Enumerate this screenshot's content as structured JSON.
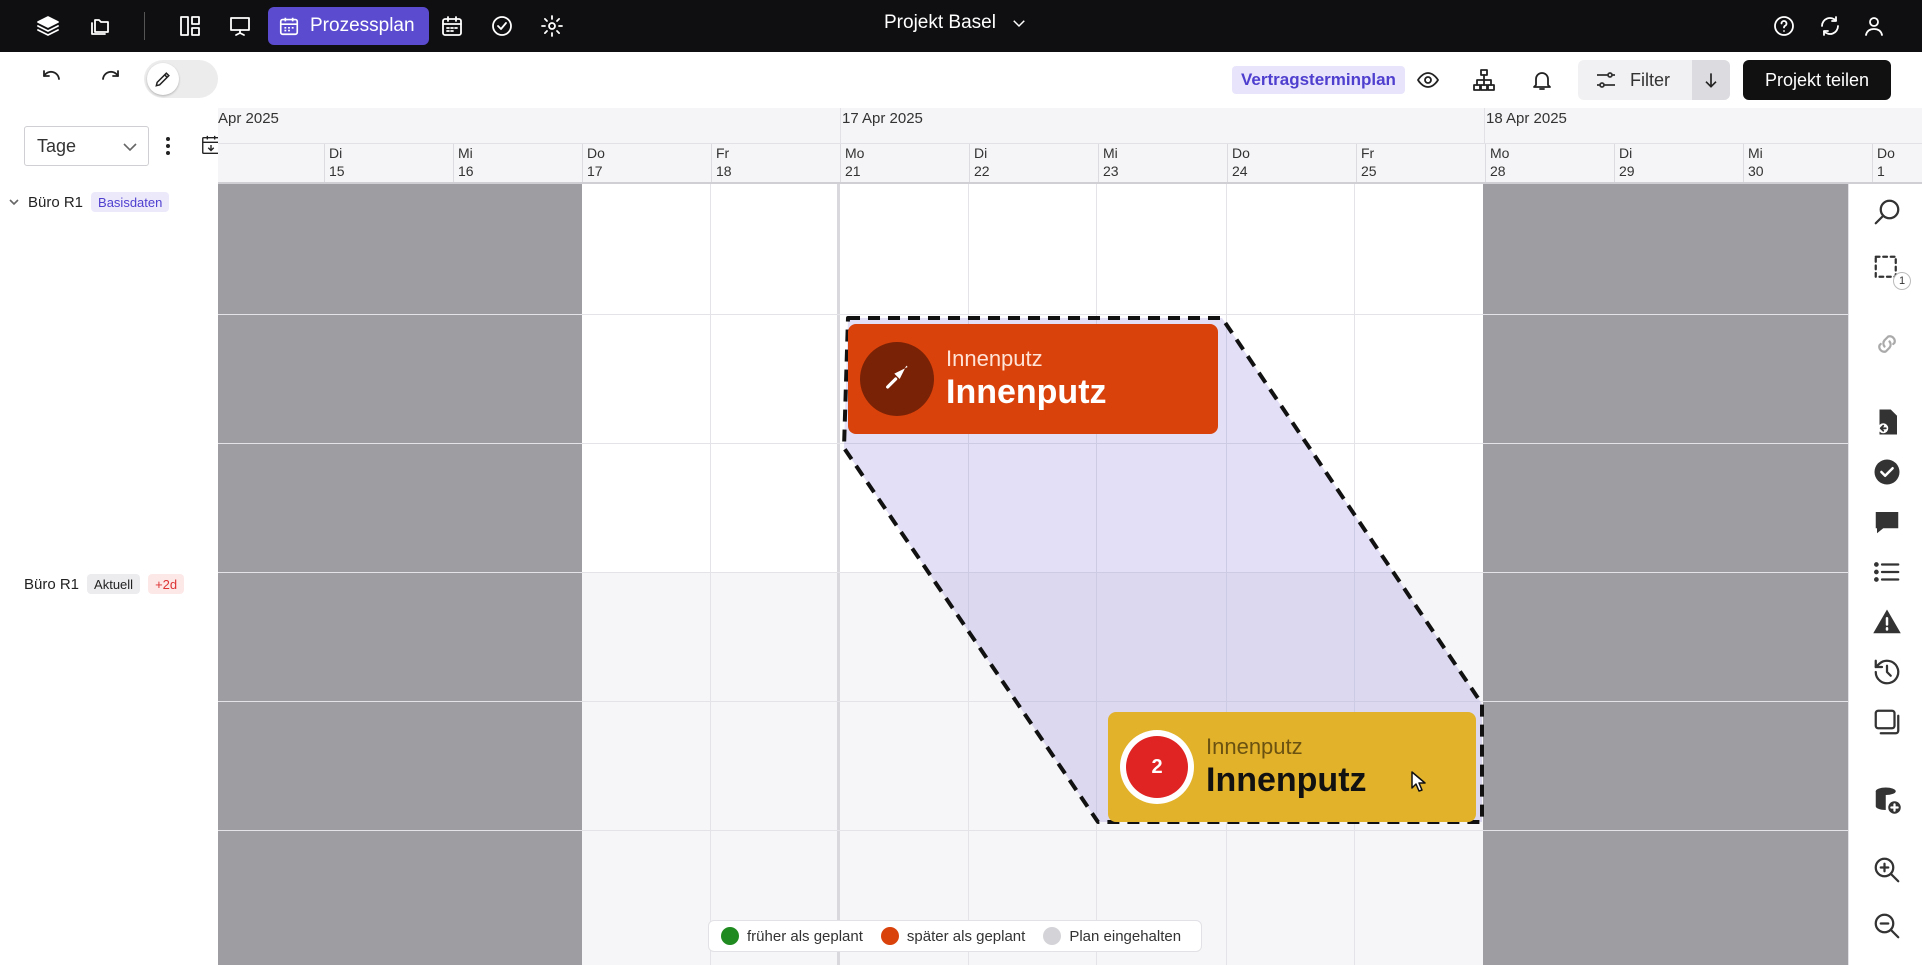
{
  "header": {
    "tab_prozessplan": "Prozessplan",
    "project_title": "Projekt Basel"
  },
  "toolbar": {
    "plan_badge": "Vertragsterminplan",
    "filter_label": "Filter",
    "share_label": "Projekt teilen"
  },
  "timeline": {
    "range_select_value": "Tage",
    "months": [
      "Apr 2025",
      "17 Apr 2025",
      "18 Apr 2025"
    ],
    "days": [
      {
        "dow": "Di",
        "num": "15"
      },
      {
        "dow": "Mi",
        "num": "16"
      },
      {
        "dow": "Do",
        "num": "17"
      },
      {
        "dow": "Fr",
        "num": "18"
      },
      {
        "dow": "Mo",
        "num": "21"
      },
      {
        "dow": "Di",
        "num": "22"
      },
      {
        "dow": "Mi",
        "num": "23"
      },
      {
        "dow": "Do",
        "num": "24"
      },
      {
        "dow": "Fr",
        "num": "25"
      },
      {
        "dow": "Mo",
        "num": "28"
      },
      {
        "dow": "Di",
        "num": "29"
      },
      {
        "dow": "Mi",
        "num": "30"
      },
      {
        "dow": "Do",
        "num": "1"
      }
    ]
  },
  "rows": [
    {
      "label": "Büro R1",
      "tag": "Basisdaten"
    },
    {
      "label": "Büro R1",
      "tag": "Aktuell",
      "delta": "+2d"
    }
  ],
  "tasks": {
    "planned": {
      "subtitle": "Innenputz",
      "title": "Innenputz",
      "color": "#d9420b"
    },
    "actual": {
      "subtitle": "Innenputz",
      "title": "Innenputz",
      "badge": "2",
      "color": "#e2b22b"
    }
  },
  "legend": [
    {
      "label": "früher als geplant",
      "color": "#1f8a1f"
    },
    {
      "label": "später als geplant",
      "color": "#d9420b"
    },
    {
      "label": "Plan eingehalten",
      "color": "#d4d4d8"
    }
  ],
  "right_rail": {
    "selection_count": "1"
  },
  "colors": {
    "accent": "#5b4ccf",
    "topbar": "#0f0f12",
    "weekend": "#9d9da2"
  }
}
